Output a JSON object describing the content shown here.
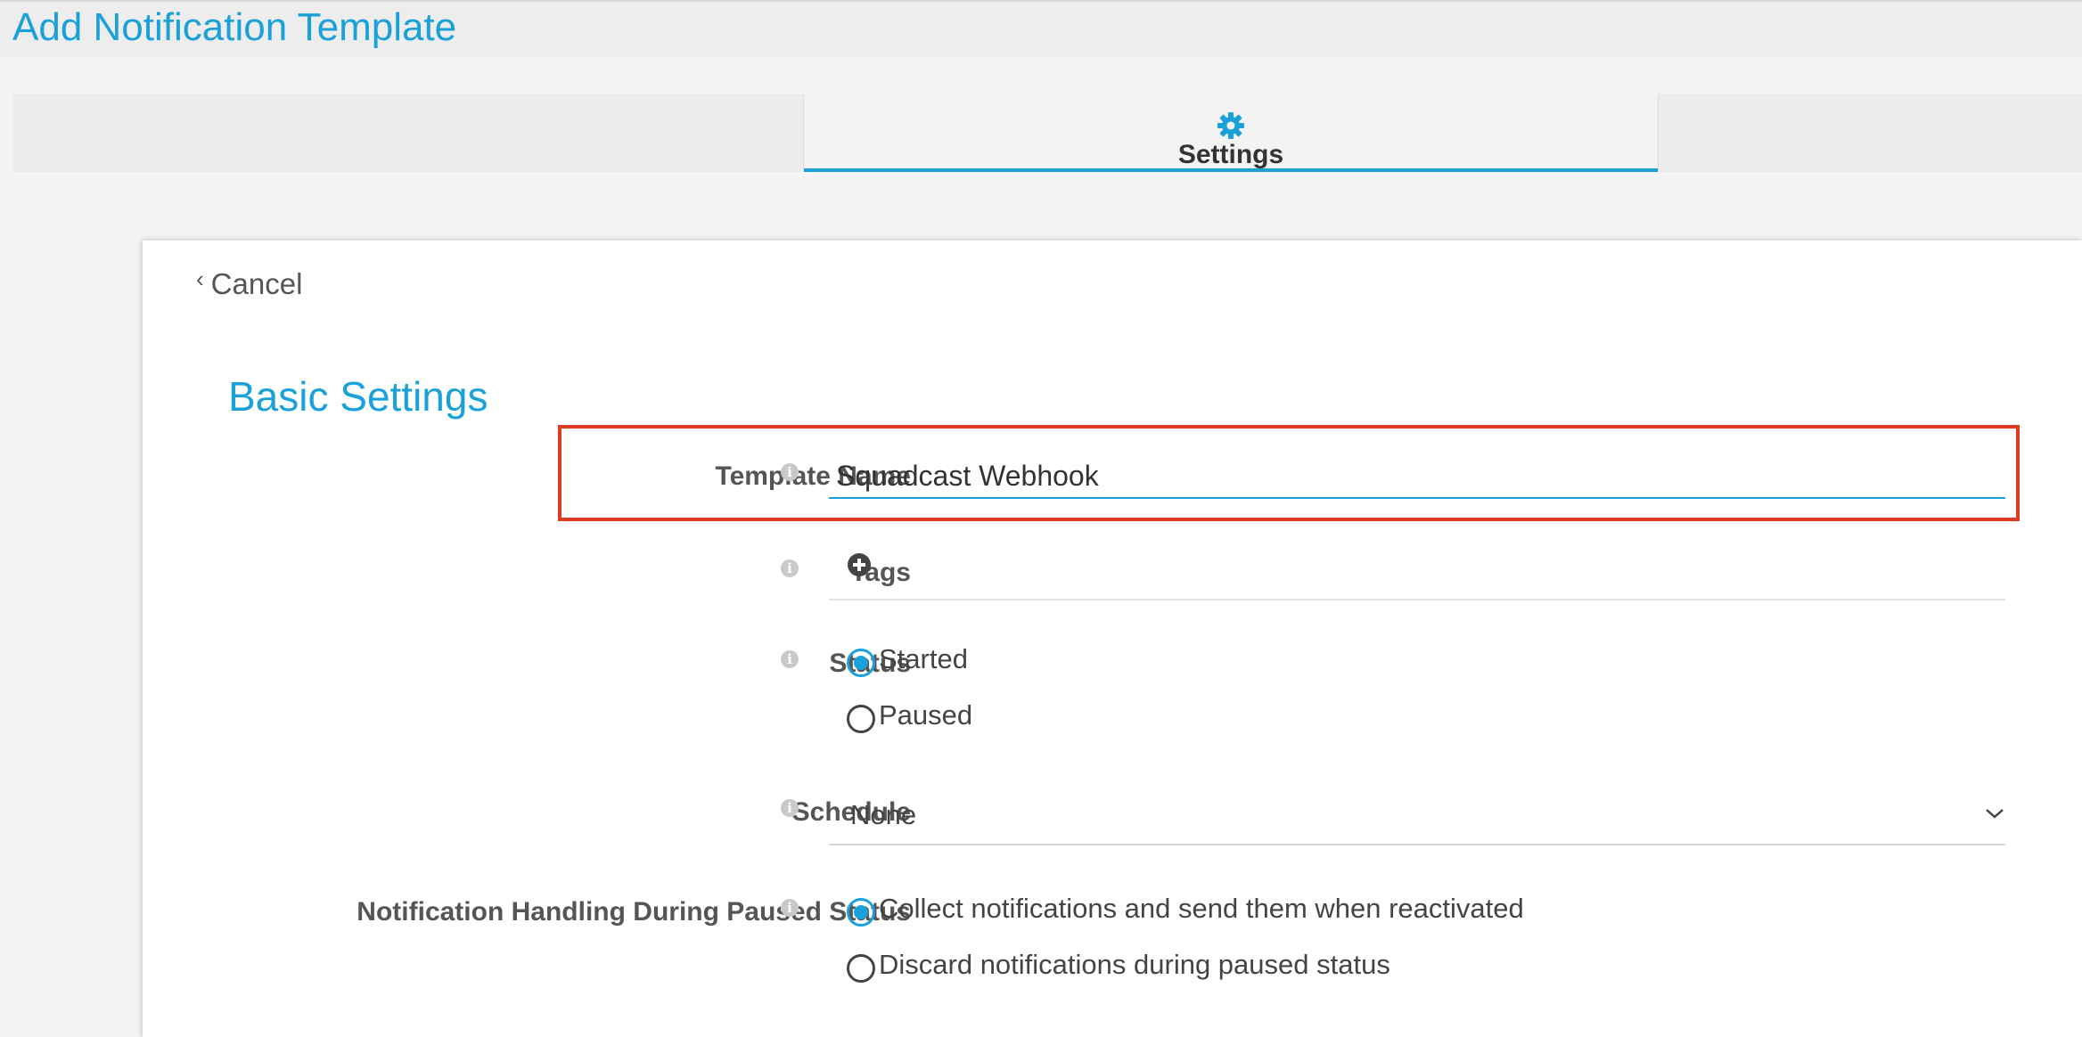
{
  "page": {
    "title": "Add Notification Template"
  },
  "tabs": [
    {
      "label": ""
    },
    {
      "label": "Settings",
      "icon": "gear-icon",
      "active": true
    },
    {
      "label": ""
    }
  ],
  "colors": {
    "accent": "#1ba1d9",
    "highlight": "#e03a22"
  },
  "form": {
    "cancel_label": "Cancel",
    "section_title": "Basic Settings",
    "template_name": {
      "label": "Template Name",
      "value": "Squadcast Webhook"
    },
    "tags": {
      "label": "Tags",
      "add_icon": "plus-circle-icon"
    },
    "status": {
      "label": "Status",
      "options": [
        {
          "label": "Started",
          "selected": true
        },
        {
          "label": "Paused",
          "selected": false
        }
      ]
    },
    "schedule": {
      "label": "Schedule",
      "value": "None"
    },
    "paused_handling": {
      "label": "Notification Handling During Paused Status",
      "options": [
        {
          "label": "Collect notifications and send them when reactivated",
          "selected": true
        },
        {
          "label": "Discard notifications during paused status",
          "selected": false
        }
      ]
    }
  }
}
